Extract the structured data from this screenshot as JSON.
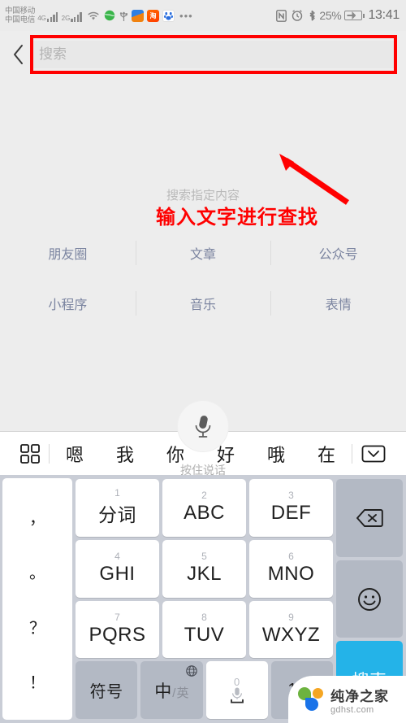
{
  "statusbar": {
    "carrier_line1": "中国移动",
    "carrier_line2": "中国电信",
    "signal1_label": "4G",
    "signal2_label": "2G",
    "icons": [
      "wifi-icon",
      "location-icon",
      "usb-icon",
      "netease-music-icon",
      "taobao-icon",
      "baidu-icon",
      "more-dots-icon",
      "nfc-icon",
      "alarm-icon",
      "bluetooth-icon"
    ],
    "battery_percent": "25%",
    "time": "13:41"
  },
  "header": {
    "back_label": "‹",
    "search_placeholder": "搜索",
    "search_value": ""
  },
  "annotation": {
    "callout_text": "输入文字进行查找",
    "color": "#ff0000"
  },
  "main": {
    "hint": "搜索指定内容",
    "categories_row1": [
      "朋友圈",
      "文章",
      "公众号"
    ],
    "categories_row2": [
      "小程序",
      "音乐",
      "表情"
    ],
    "category_color": "#7b84a0",
    "voice": {
      "icon": "microphone-icon",
      "label": "按住说话"
    }
  },
  "suggestion_bar": {
    "left_icon": "grid-menu-icon",
    "words": [
      "嗯",
      "我",
      "你",
      "好",
      "哦",
      "在"
    ],
    "right_icon": "chevron-down-box-icon"
  },
  "keyboard": {
    "punctuation": [
      "，",
      "。",
      "？",
      "！"
    ],
    "rows": [
      [
        {
          "num": "1",
          "label": "分词",
          "type": "cn"
        },
        {
          "num": "2",
          "label": "ABC",
          "type": "en"
        },
        {
          "num": "3",
          "label": "DEF",
          "type": "en"
        }
      ],
      [
        {
          "num": "4",
          "label": "GHI",
          "type": "en"
        },
        {
          "num": "5",
          "label": "JKL",
          "type": "en"
        },
        {
          "num": "6",
          "label": "MNO",
          "type": "en"
        }
      ],
      [
        {
          "num": "7",
          "label": "PQRS",
          "type": "en"
        },
        {
          "num": "8",
          "label": "TUV",
          "type": "en"
        },
        {
          "num": "9",
          "label": "WXYZ",
          "type": "en"
        }
      ]
    ],
    "bottom_row": {
      "symbol_label": "符号",
      "lang_zh": "中",
      "lang_sep": "/",
      "lang_en": "英",
      "globe_icon": "globe-icon",
      "space_zero": "0",
      "space_icon": "microphone-icon",
      "numeric_label": "123"
    },
    "right_column": {
      "backspace_icon": "backspace-icon",
      "emoji_icon": "emoji-smiley-icon",
      "enter_label": "搜索"
    },
    "accent_color": "#24b3e8"
  },
  "watermark": {
    "name": "纯净之家",
    "url": "gdhst.com"
  }
}
